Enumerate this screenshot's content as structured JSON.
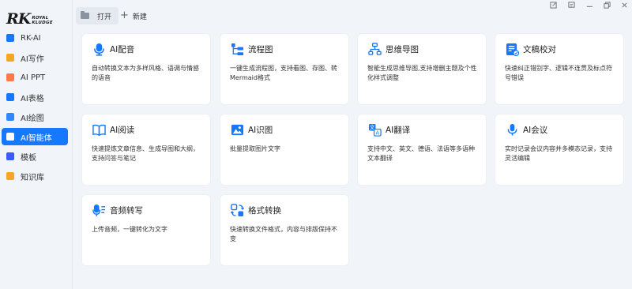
{
  "brand": {
    "logo_main": "RK",
    "logo_line1": "ROYAL",
    "logo_line2": "KLUDGE"
  },
  "sidebar": {
    "items": [
      {
        "label": "RK-AI",
        "color": "#1677ff",
        "icon": "rk-ai-icon"
      },
      {
        "label": "AI写作",
        "color": "#f5a623",
        "icon": "ai-writing-icon"
      },
      {
        "label": "AI PPT",
        "color": "#ff7a45",
        "icon": "ai-ppt-icon"
      },
      {
        "label": "AI表格",
        "color": "#1677ff",
        "icon": "ai-sheet-icon"
      },
      {
        "label": "AI绘图",
        "color": "#2f88ff",
        "icon": "ai-drawing-icon"
      },
      {
        "label": "AI智能体",
        "color": "#1677ff",
        "icon": "ai-agent-icon",
        "active": true
      },
      {
        "label": "模板",
        "color": "#3d5afe",
        "icon": "template-icon"
      },
      {
        "label": "知识库",
        "color": "#f5a623",
        "icon": "knowledge-base-icon"
      }
    ]
  },
  "topbar": {
    "open_label": "打开",
    "new_label": "新建"
  },
  "cards": [
    {
      "title": "AI配音",
      "desc": "自动转换文本为多样风格、语调与情感的语音",
      "icon": "voiceover-icon"
    },
    {
      "title": "流程图",
      "desc": "一键生成流程图，支持看图、存图、转Mermaid格式",
      "icon": "flowchart-icon"
    },
    {
      "title": "思维导图",
      "desc": "智能生成思维导图,支持增删主题及个性化样式调整",
      "icon": "mindmap-icon"
    },
    {
      "title": "文稿校对",
      "desc": "快速纠正错别字、逻辑不连贯及标点符号错误",
      "icon": "proofread-icon"
    },
    {
      "title": "AI阅读",
      "desc": "快速提炼文章信息、生成导图和大纲，支持问答与笔记",
      "icon": "reading-icon"
    },
    {
      "title": "AI识图",
      "desc": "批量提取图片文字",
      "icon": "image-recognition-icon"
    },
    {
      "title": "AI翻译",
      "desc": "支持中文、英文、德语、法语等多语种文本翻译",
      "icon": "translate-icon"
    },
    {
      "title": "AI会议",
      "desc": "实时记录会议内容并多模态记录，支持灵活编辑",
      "icon": "meeting-icon"
    },
    {
      "title": "音频转写",
      "desc": "上传音频，一键转化为文字",
      "icon": "audio-transcribe-icon"
    },
    {
      "title": "格式转换",
      "desc": "快速转换文件格式，内容与排版保持不变",
      "icon": "format-convert-icon"
    }
  ]
}
